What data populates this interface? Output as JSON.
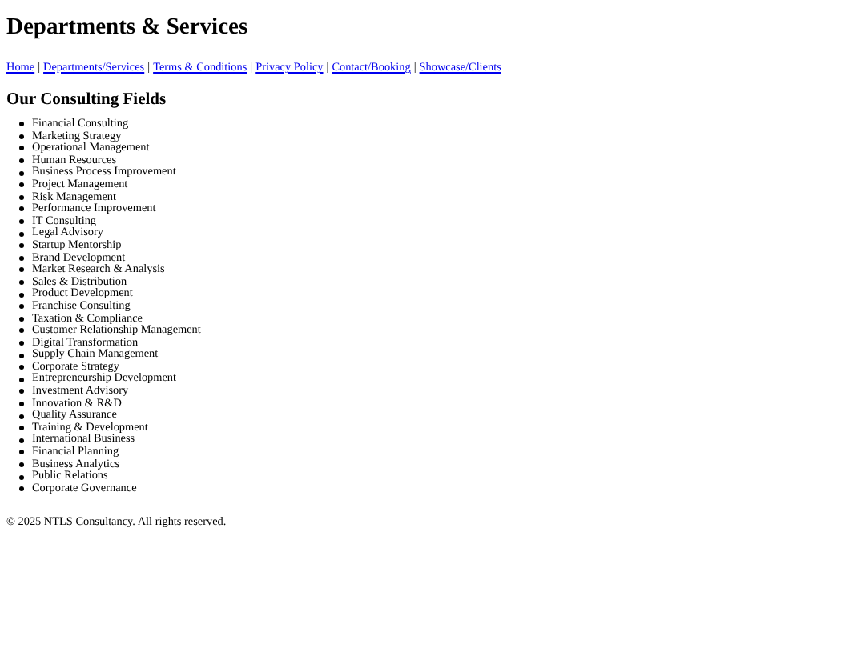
{
  "title": "Departments & Services",
  "nav": {
    "separator": "|",
    "links": [
      "Home",
      "Departments/Services",
      "Terms & Conditions",
      "Privacy Policy",
      "Contact/Booking",
      "Showcase/Clients"
    ]
  },
  "section": {
    "heading": "Our Consulting Fields",
    "items": [
      "Financial Consulting",
      "Marketing Strategy",
      "Operational Management",
      "Human Resources",
      "Business Process Improvement",
      "Project Management",
      "Risk Management",
      "Performance Improvement",
      "IT Consulting",
      "Legal Advisory",
      "Startup Mentorship",
      "Brand Development",
      "Market Research & Analysis",
      "Sales & Distribution",
      "Product Development",
      "Franchise Consulting",
      "Taxation & Compliance",
      "Customer Relationship Management",
      "Digital Transformation",
      "Supply Chain Management",
      "Corporate Strategy",
      "Entrepreneurship Development",
      "Investment Advisory",
      "Innovation & R&D",
      "Quality Assurance",
      "Training & Development",
      "International Business",
      "Financial Planning",
      "Business Analytics",
      "Public Relations",
      "Corporate Governance"
    ]
  },
  "footer": "© 2025 NTLS Consultancy. All rights reserved."
}
